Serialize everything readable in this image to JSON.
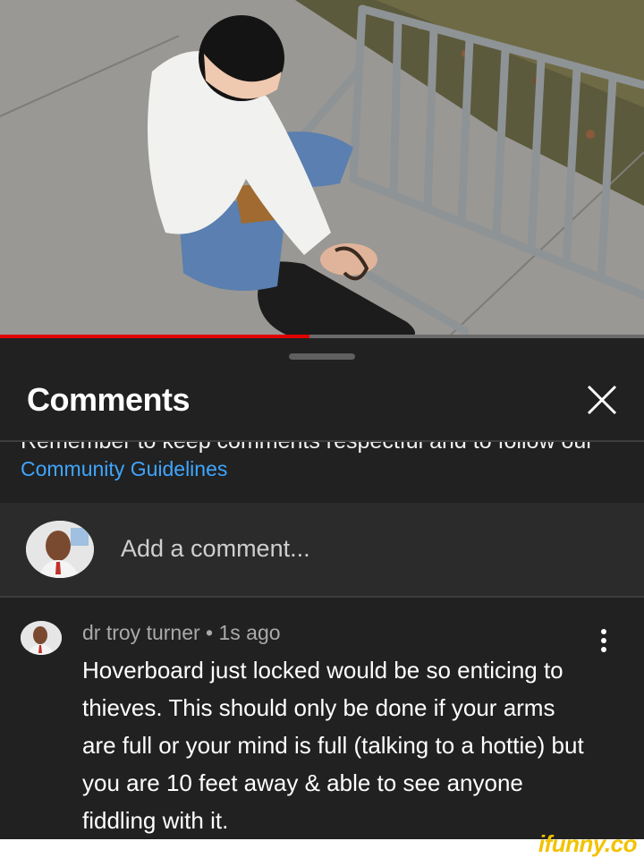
{
  "video": {
    "progress_fraction": 0.48
  },
  "comments_panel": {
    "title": "Comments",
    "reminder_text": "Remember to keep comments respectful and to follow our",
    "guidelines_link": "Community Guidelines",
    "add_comment_placeholder": "Add a comment..."
  },
  "comment": {
    "author": "dr troy turner",
    "separator": "•",
    "time": "1s ago",
    "text": "Hoverboard just locked would be so enticing to thieves. This should only be done if your arms are full or your mind is full (talking to a hottie) but you are 10 feet away & able to see anyone fiddling with it."
  },
  "watermark": "ifunny.co",
  "colors": {
    "background": "#212121",
    "link": "#3ea6ff",
    "progress": "#e00000",
    "watermark": "#f2c200"
  }
}
